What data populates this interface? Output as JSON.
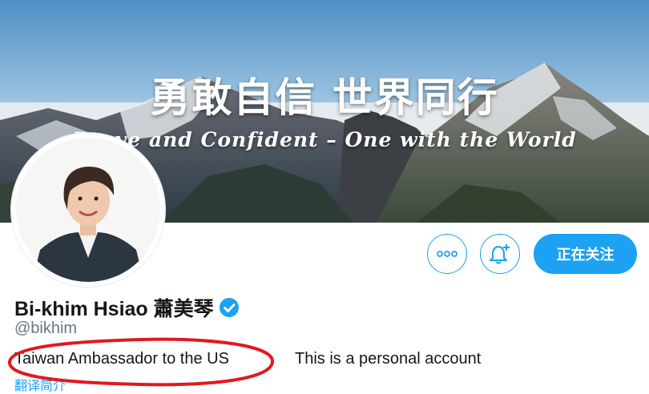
{
  "banner": {
    "title": "勇敢自信 世界同行",
    "subtitle": "Brave and Confident – One with the World"
  },
  "profile": {
    "display_name": "Bi-khim Hsiao 蕭美琴",
    "handle": "@bikhim",
    "verified_icon": "verified-badge-icon",
    "bio_title": "Taiwan Ambassador to the US",
    "bio_note": "This is a personal account",
    "translate_link": "翻译简介"
  },
  "actions": {
    "more_icon": "more-dots-icon",
    "notify_icon": "bell-plus-icon",
    "follow_label": "正在关注"
  },
  "colors": {
    "accent": "#1da1f2",
    "annotation": "#e0191f",
    "text": "#14171a",
    "muted": "#657786"
  }
}
